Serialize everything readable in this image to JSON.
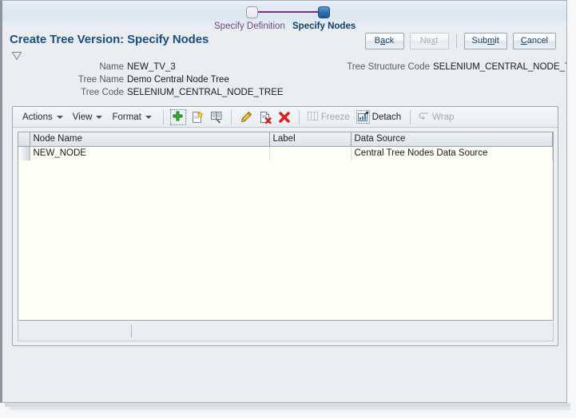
{
  "train": {
    "steps": [
      {
        "label": "Specify Definition",
        "state": "done"
      },
      {
        "label": "Specify Nodes",
        "state": "current"
      }
    ]
  },
  "header": {
    "title": "Create Tree Version: Specify Nodes",
    "disclosure_icon": "triangle-down-icon",
    "buttons": {
      "back": {
        "pre": "B",
        "mn": "a",
        "post": "ck",
        "enabled": true
      },
      "next": {
        "pre": "Ne",
        "mn": "x",
        "post": "t",
        "enabled": false
      },
      "submit": {
        "pre": "Sub",
        "mn": "m",
        "post": "it",
        "enabled": true
      },
      "cancel": {
        "pre": "",
        "mn": "C",
        "post": "ancel",
        "enabled": true
      }
    }
  },
  "fields": {
    "left": [
      {
        "label": "Name",
        "value": "NEW_TV_3"
      },
      {
        "label": "Tree Name",
        "value": "Demo Central Node Tree"
      },
      {
        "label": "Tree Code",
        "value": "SELENIUM_CENTRAL_NODE_TREE"
      }
    ],
    "right": [
      {
        "label": "Tree Structure Code",
        "value": "SELENIUM_CENTRAL_NODE_TS"
      }
    ]
  },
  "toolbar": {
    "menus": [
      {
        "label": "Actions",
        "name": "actions-menu"
      },
      {
        "label": "View",
        "name": "view-menu"
      },
      {
        "label": "Format",
        "name": "format-menu"
      }
    ],
    "icons": [
      {
        "name": "add-row-icon",
        "title": "Add",
        "focused": true
      },
      {
        "name": "create-child-node-icon",
        "title": "Create Child Node",
        "focused": false
      },
      {
        "name": "duplicate-node-icon",
        "title": "Duplicate",
        "focused": false
      }
    ],
    "icons2": [
      {
        "name": "edit-pencil-icon",
        "title": "Edit"
      },
      {
        "name": "delete-row-icon",
        "title": "Delete Row"
      },
      {
        "name": "delete-icon",
        "title": "Delete"
      }
    ],
    "buttons": [
      {
        "name": "freeze-button",
        "label": "Freeze",
        "icon": "freeze-columns-icon",
        "enabled": false
      },
      {
        "name": "detach-button",
        "label": "Detach",
        "icon": "detach-icon",
        "enabled": true
      },
      {
        "name": "wrap-button",
        "label": "Wrap",
        "icon": "wrap-text-icon",
        "enabled": false
      }
    ]
  },
  "table": {
    "columns": [
      "Node Name",
      "Label",
      "Data Source"
    ],
    "rows": [
      {
        "node_name": "NEW_NODE",
        "label": "",
        "data_source": "Central Tree Nodes Data Source"
      }
    ]
  },
  "colors": {
    "title": "#1b4f7e",
    "train_line": "#7b2d7b",
    "train_current": "#2f6fa8",
    "table_body": "#fffff5"
  }
}
